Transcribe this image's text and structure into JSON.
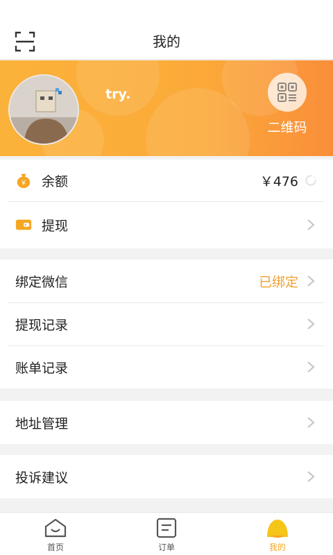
{
  "header": {
    "title": "我的"
  },
  "profile": {
    "username": "try.",
    "qr_label": "二维码"
  },
  "wallet": {
    "balance_label": "余额",
    "balance_value": "￥476",
    "withdraw_label": "提现"
  },
  "account": {
    "items": [
      {
        "label": "绑定微信",
        "value": "已绑定"
      },
      {
        "label": "提现记录"
      },
      {
        "label": "账单记录"
      }
    ]
  },
  "address": {
    "label": "地址管理"
  },
  "complaint": {
    "label": "投诉建议"
  },
  "tabbar": {
    "items": [
      {
        "label": "首页",
        "icon": "home-icon"
      },
      {
        "label": "订单",
        "icon": "order-icon"
      },
      {
        "label": "我的",
        "icon": "profile-icon",
        "active": true
      }
    ]
  },
  "colors": {
    "accent": "#fbaa39",
    "status": "#f0a030"
  },
  "icons": {
    "scan": "scan-icon",
    "qr": "qr-code-icon",
    "money_bag": "money-bag-icon",
    "wallet": "wallet-icon",
    "refresh": "refresh-icon",
    "chevron": "chevron-right-icon"
  }
}
